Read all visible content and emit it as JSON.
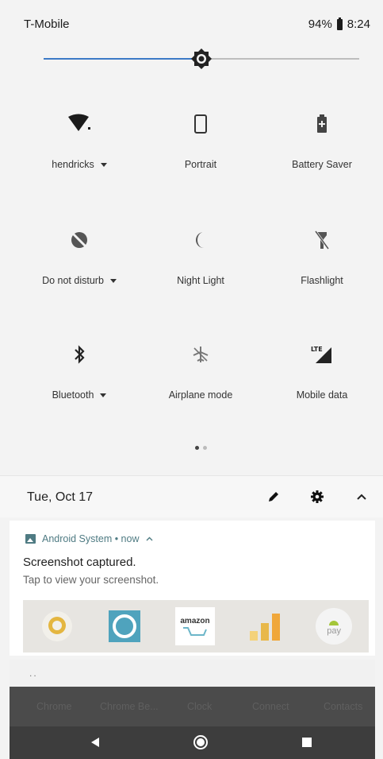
{
  "status_bar": {
    "carrier": "T-Mobile",
    "battery": "94%",
    "time": "8:24"
  },
  "brightness": {
    "level": 0.5
  },
  "tiles": [
    {
      "label": "hendricks",
      "icon": "wifi-icon",
      "has_dropdown": true
    },
    {
      "label": "Portrait",
      "icon": "portrait-icon",
      "has_dropdown": false
    },
    {
      "label": "Battery Saver",
      "icon": "battery-saver-icon",
      "has_dropdown": false
    },
    {
      "label": "Do not disturb",
      "icon": "do-not-disturb-icon",
      "has_dropdown": true
    },
    {
      "label": "Night Light",
      "icon": "night-light-icon",
      "has_dropdown": false
    },
    {
      "label": "Flashlight",
      "icon": "flashlight-icon",
      "has_dropdown": false
    },
    {
      "label": "Bluetooth",
      "icon": "bluetooth-icon",
      "has_dropdown": true
    },
    {
      "label": "Airplane mode",
      "icon": "airplane-icon",
      "has_dropdown": false
    },
    {
      "label": "Mobile data",
      "icon": "mobile-data-icon",
      "badge": "LTE",
      "has_dropdown": false
    }
  ],
  "date_row": {
    "date": "Tue, Oct 17"
  },
  "notification": {
    "app": "Android System • now",
    "title": "Screenshot captured.",
    "text": "Tap to view your screenshot.",
    "preview_apps": [
      {
        "icon": "allo-icon"
      },
      {
        "icon": "alexa-icon"
      },
      {
        "icon": "amazon-icon",
        "text": "amazon"
      },
      {
        "icon": "analytics-icon"
      },
      {
        "icon": "android-pay-icon",
        "text": "pay"
      }
    ]
  },
  "shelf": {
    "dots": ".."
  },
  "dock_labels": [
    "Chrome",
    "Chrome Be...",
    "Clock",
    "Connect",
    "Contacts"
  ],
  "colors": {
    "accent": "#3c7ac6",
    "notification_app": "#4f7b83"
  }
}
